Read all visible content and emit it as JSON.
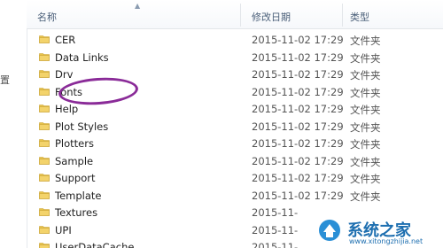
{
  "header": {
    "name_label": "名称",
    "date_label": "修改日期",
    "type_label": "类型"
  },
  "nav": {
    "partial_glyph": "置"
  },
  "rows": [
    {
      "name": "CER",
      "date": "2015-11-02 17:29",
      "type": "文件夹"
    },
    {
      "name": "Data Links",
      "date": "2015-11-02 17:29",
      "type": "文件夹"
    },
    {
      "name": "Drv",
      "date": "2015-11-02 17:29",
      "type": "文件夹"
    },
    {
      "name": "Fonts",
      "date": "2015-11-02 17:29",
      "type": "文件夹"
    },
    {
      "name": "Help",
      "date": "2015-11-02 17:29",
      "type": "文件夹"
    },
    {
      "name": "Plot Styles",
      "date": "2015-11-02 17:29",
      "type": "文件夹"
    },
    {
      "name": "Plotters",
      "date": "2015-11-02 17:29",
      "type": "文件夹"
    },
    {
      "name": "Sample",
      "date": "2015-11-02 17:29",
      "type": "文件夹"
    },
    {
      "name": "Support",
      "date": "2015-11-02 17:29",
      "type": "文件夹"
    },
    {
      "name": "Template",
      "date": "2015-11-02 17:29",
      "type": "文件夹"
    },
    {
      "name": "Textures",
      "date": "2015-11-",
      "type": ""
    },
    {
      "name": "UPI",
      "date": "2015-11-",
      "type": ""
    },
    {
      "name": "UserDataCache",
      "date": "2015-11-",
      "type": ""
    }
  ],
  "watermark": {
    "text": "系统之家",
    "url": "www.xitongzhijia.net"
  },
  "colors": {
    "highlight": "#8a2b98",
    "folder": "#e8c34a",
    "header_text": "#4c607a"
  }
}
